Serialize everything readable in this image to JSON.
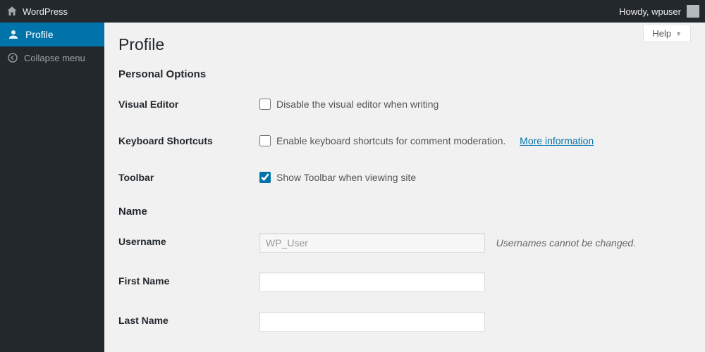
{
  "adminbar": {
    "site_name": "WordPress",
    "howdy": "Howdy, wpuser"
  },
  "sidebar": {
    "profile": "Profile",
    "collapse": "Collapse menu"
  },
  "help": {
    "label": "Help"
  },
  "page": {
    "title": "Profile",
    "section_personal": "Personal Options",
    "section_name": "Name",
    "fields": {
      "visual_editor": {
        "label": "Visual Editor",
        "checkbox": "Disable the visual editor when writing"
      },
      "keyboard": {
        "label": "Keyboard Shortcuts",
        "checkbox": "Enable keyboard shortcuts for comment moderation.",
        "more": "More information"
      },
      "toolbar": {
        "label": "Toolbar",
        "checkbox": "Show Toolbar when viewing site"
      },
      "username": {
        "label": "Username",
        "value": "WP_User",
        "desc": "Usernames cannot be changed."
      },
      "first_name": {
        "label": "First Name",
        "value": ""
      },
      "last_name": {
        "label": "Last Name",
        "value": ""
      }
    }
  }
}
